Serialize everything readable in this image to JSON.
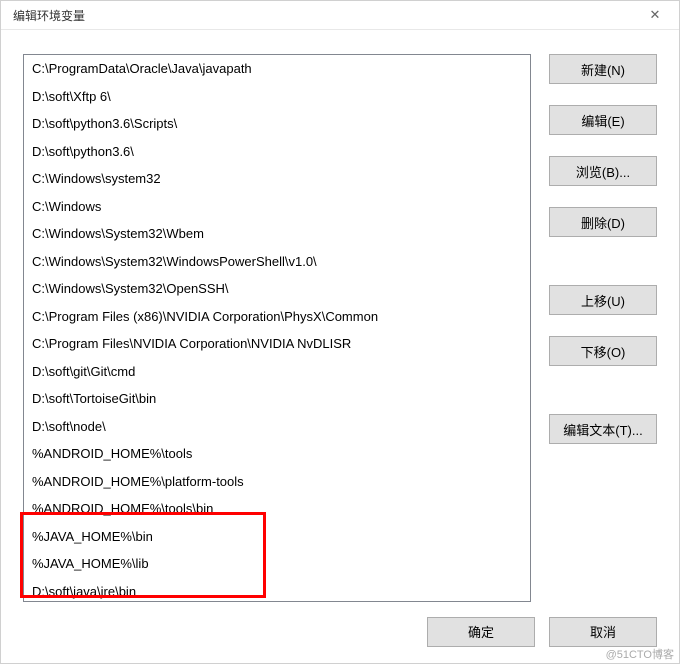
{
  "title": "编辑环境变量",
  "close": "✕",
  "list": {
    "items": [
      "C:\\ProgramData\\Oracle\\Java\\javapath",
      "D:\\soft\\Xftp 6\\",
      "D:\\soft\\python3.6\\Scripts\\",
      "D:\\soft\\python3.6\\",
      "C:\\Windows\\system32",
      "C:\\Windows",
      "C:\\Windows\\System32\\Wbem",
      "C:\\Windows\\System32\\WindowsPowerShell\\v1.0\\",
      "C:\\Windows\\System32\\OpenSSH\\",
      "C:\\Program Files (x86)\\NVIDIA Corporation\\PhysX\\Common",
      "C:\\Program Files\\NVIDIA Corporation\\NVIDIA NvDLISR",
      "D:\\soft\\git\\Git\\cmd",
      "D:\\soft\\TortoiseGit\\bin",
      "D:\\soft\\node\\",
      "%ANDROID_HOME%\\tools",
      "%ANDROID_HOME%\\platform-tools",
      "%ANDROID_HOME%\\tools\\bin",
      "%JAVA_HOME%\\bin",
      "%JAVA_HOME%\\lib",
      "D:\\soft\\java\\jre\\bin"
    ]
  },
  "buttons": {
    "new": "新建(N)",
    "edit": "编辑(E)",
    "browse": "浏览(B)...",
    "delete": "删除(D)",
    "moveUp": "上移(U)",
    "moveDown": "下移(O)",
    "editText": "编辑文本(T)...",
    "ok": "确定",
    "cancel": "取消"
  },
  "watermark": "@51CTO博客"
}
